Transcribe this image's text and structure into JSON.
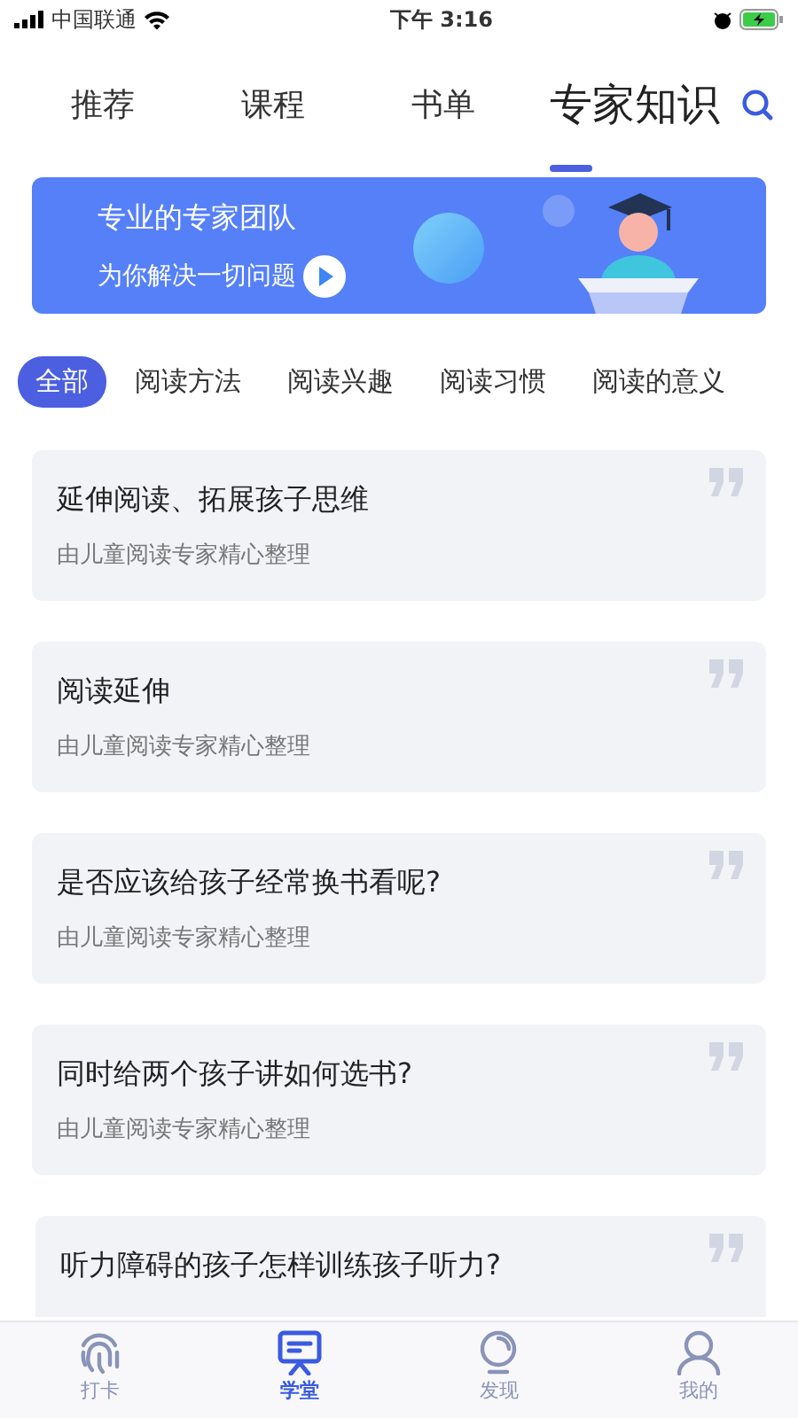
{
  "status_bar": {
    "carrier": "中国联通",
    "time": "下午 3:16"
  },
  "top_tabs": [
    {
      "label": "推荐",
      "selected": false
    },
    {
      "label": "课程",
      "selected": false
    },
    {
      "label": "书单",
      "selected": false
    },
    {
      "label": "专家知识",
      "selected": true
    }
  ],
  "banner": {
    "title": "专业的专家团队",
    "subtitle": "为你解决一切问题"
  },
  "categories": [
    {
      "label": "全部",
      "selected": true
    },
    {
      "label": "阅读方法",
      "selected": false
    },
    {
      "label": "阅读兴趣",
      "selected": false
    },
    {
      "label": "阅读习惯",
      "selected": false
    },
    {
      "label": "阅读的意义",
      "selected": false
    }
  ],
  "articles": [
    {
      "title": "延伸阅读、拓展孩子思维",
      "subtitle": "由儿童阅读专家精心整理"
    },
    {
      "title": "阅读延伸",
      "subtitle": "由儿童阅读专家精心整理"
    },
    {
      "title": "是否应该给孩子经常换书看呢?",
      "subtitle": "由儿童阅读专家精心整理"
    },
    {
      "title": "同时给两个孩子讲如何选书?",
      "subtitle": "由儿童阅读专家精心整理"
    },
    {
      "title": "听力障碍的孩子怎样训练孩子听力?"
    }
  ],
  "bottom_tabs": [
    {
      "label": "打卡",
      "kind": "fingerprint",
      "selected": false
    },
    {
      "label": "学堂",
      "kind": "classroom",
      "selected": true
    },
    {
      "label": "发现",
      "kind": "bulb",
      "selected": false
    },
    {
      "label": "我的",
      "kind": "person",
      "selected": false
    }
  ]
}
